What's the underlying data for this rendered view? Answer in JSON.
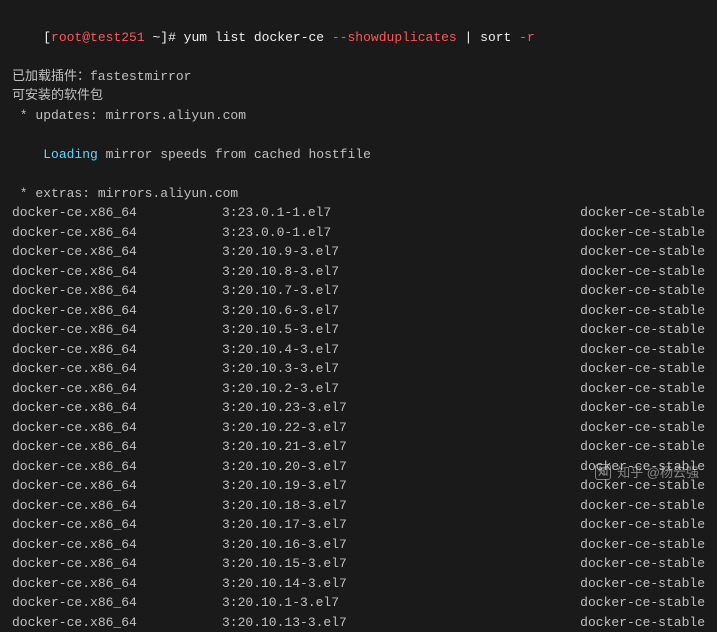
{
  "prompt": {
    "open_bracket": "[",
    "user_host": "root@test251",
    "path": " ~",
    "close_bracket": "]# ",
    "cmd_prefix": "yum list docker-ce ",
    "flag": "--showduplicates",
    "cmd_suffix": " | sort ",
    "sort_flag": "-r"
  },
  "header": {
    "plugins": "已加载插件：fastestmirror",
    "available": "可安装的软件包",
    "updates": " * updates: mirrors.aliyun.com",
    "loading_word": "Loading",
    "loading_rest": " mirror speeds from cached hostfile",
    "extras": " * extras: mirrors.aliyun.com"
  },
  "rows": [
    {
      "pkg": "docker-ce.x86_64",
      "ver": "3:23.0.1-1.el7",
      "repo": "docker-ce-stable"
    },
    {
      "pkg": "docker-ce.x86_64",
      "ver": "3:23.0.0-1.el7",
      "repo": "docker-ce-stable"
    },
    {
      "pkg": "docker-ce.x86_64",
      "ver": "3:20.10.9-3.el7",
      "repo": "docker-ce-stable"
    },
    {
      "pkg": "docker-ce.x86_64",
      "ver": "3:20.10.8-3.el7",
      "repo": "docker-ce-stable"
    },
    {
      "pkg": "docker-ce.x86_64",
      "ver": "3:20.10.7-3.el7",
      "repo": "docker-ce-stable"
    },
    {
      "pkg": "docker-ce.x86_64",
      "ver": "3:20.10.6-3.el7",
      "repo": "docker-ce-stable"
    },
    {
      "pkg": "docker-ce.x86_64",
      "ver": "3:20.10.5-3.el7",
      "repo": "docker-ce-stable"
    },
    {
      "pkg": "docker-ce.x86_64",
      "ver": "3:20.10.4-3.el7",
      "repo": "docker-ce-stable"
    },
    {
      "pkg": "docker-ce.x86_64",
      "ver": "3:20.10.3-3.el7",
      "repo": "docker-ce-stable"
    },
    {
      "pkg": "docker-ce.x86_64",
      "ver": "3:20.10.2-3.el7",
      "repo": "docker-ce-stable"
    },
    {
      "pkg": "docker-ce.x86_64",
      "ver": "3:20.10.23-3.el7",
      "repo": "docker-ce-stable"
    },
    {
      "pkg": "docker-ce.x86_64",
      "ver": "3:20.10.22-3.el7",
      "repo": "docker-ce-stable"
    },
    {
      "pkg": "docker-ce.x86_64",
      "ver": "3:20.10.21-3.el7",
      "repo": "docker-ce-stable"
    },
    {
      "pkg": "docker-ce.x86_64",
      "ver": "3:20.10.20-3.el7",
      "repo": "docker-ce-stable"
    },
    {
      "pkg": "docker-ce.x86_64",
      "ver": "3:20.10.19-3.el7",
      "repo": "docker-ce-stable"
    },
    {
      "pkg": "docker-ce.x86_64",
      "ver": "3:20.10.18-3.el7",
      "repo": "docker-ce-stable"
    },
    {
      "pkg": "docker-ce.x86_64",
      "ver": "3:20.10.17-3.el7",
      "repo": "docker-ce-stable"
    },
    {
      "pkg": "docker-ce.x86_64",
      "ver": "3:20.10.16-3.el7",
      "repo": "docker-ce-stable"
    },
    {
      "pkg": "docker-ce.x86_64",
      "ver": "3:20.10.15-3.el7",
      "repo": "docker-ce-stable"
    },
    {
      "pkg": "docker-ce.x86_64",
      "ver": "3:20.10.14-3.el7",
      "repo": "docker-ce-stable"
    },
    {
      "pkg": "docker-ce.x86_64",
      "ver": "3:20.10.1-3.el7",
      "repo": "docker-ce-stable"
    },
    {
      "pkg": "docker-ce.x86_64",
      "ver": "3:20.10.13-3.el7",
      "repo": "docker-ce-stable"
    }
  ],
  "watermark": {
    "icon": "知",
    "text": "知乎 @杨云强"
  }
}
